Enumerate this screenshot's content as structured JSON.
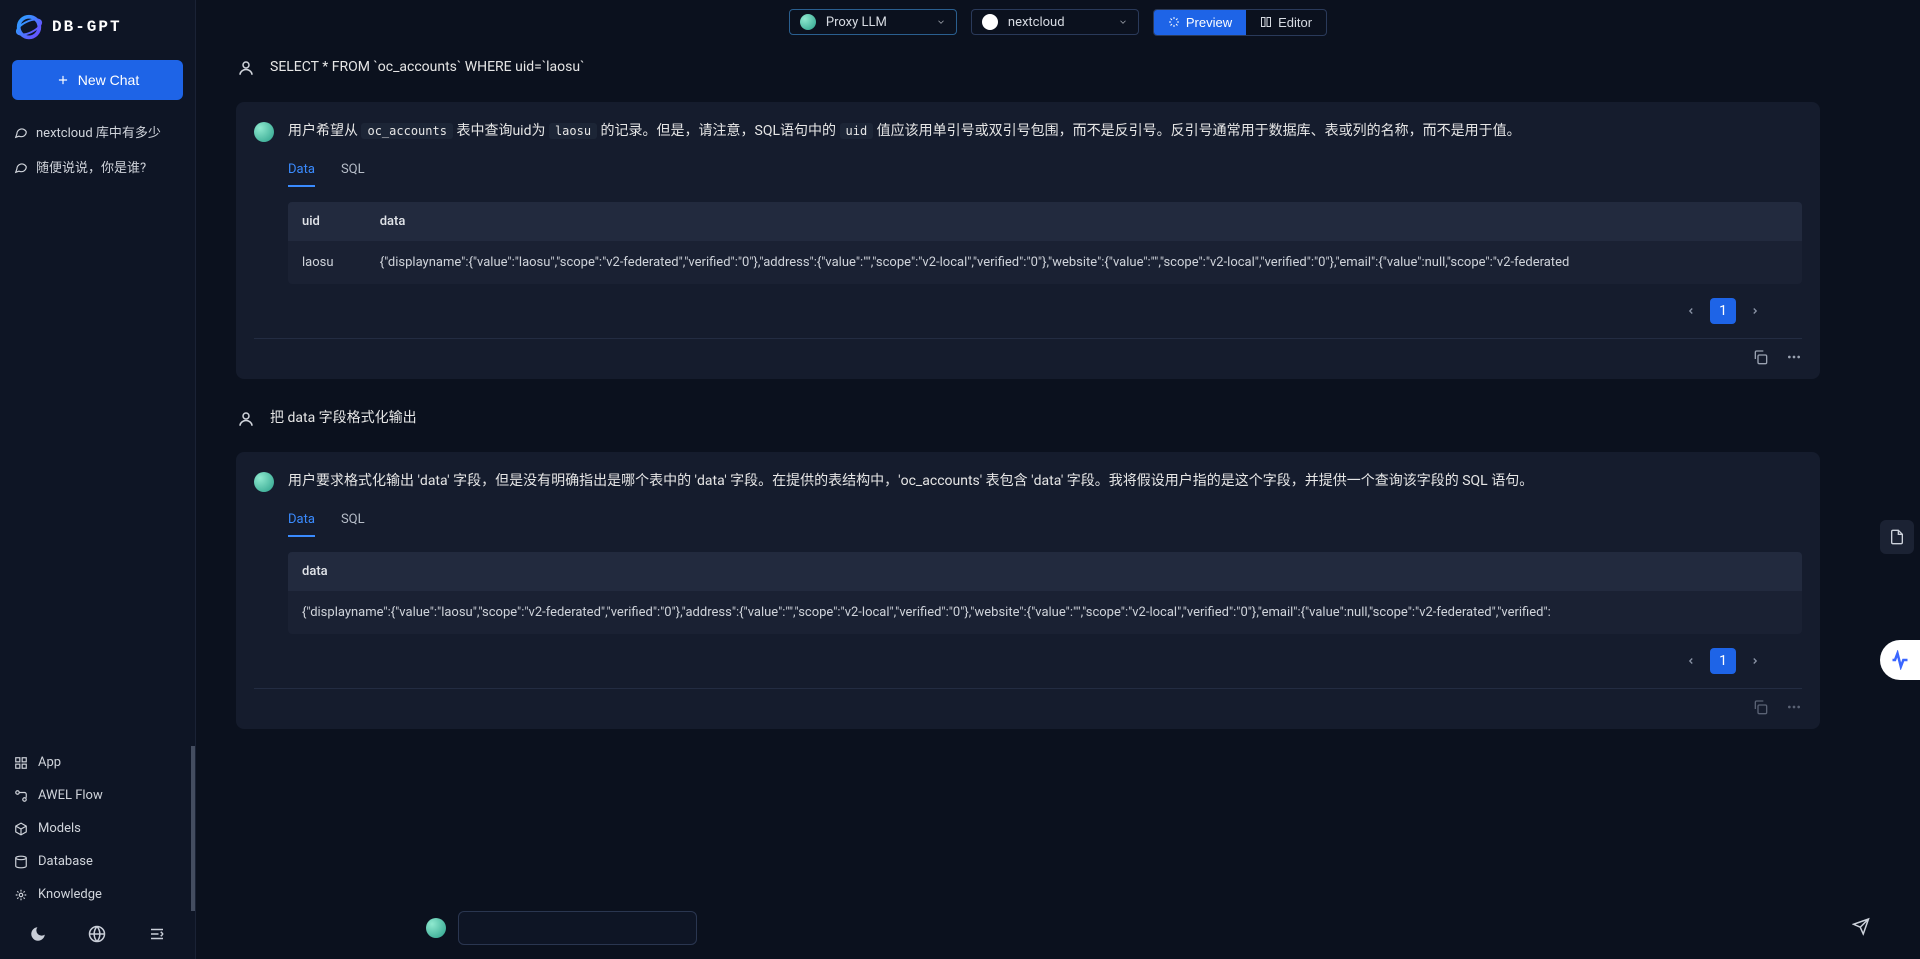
{
  "brand": "DB-GPT",
  "sidebar": {
    "new_chat_label": "New Chat",
    "chats": [
      {
        "title": "nextcloud 库中有多少"
      },
      {
        "title": "随便说说，你是谁?"
      }
    ],
    "nav": {
      "app": "App",
      "awel": "AWEL Flow",
      "models": "Models",
      "database": "Database",
      "knowledge": "Knowledge"
    }
  },
  "topbar": {
    "model_label": "Proxy LLM",
    "db_label": "nextcloud",
    "preview_label": "Preview",
    "editor_label": "Editor"
  },
  "conversation": {
    "user1": "SELECT * FROM `oc_accounts` WHERE uid=`laosu`",
    "bot1": {
      "text_pre": "用户希望从 ",
      "code1": "oc_accounts",
      "text_mid1": " 表中查询uid为 ",
      "code2": "laosu",
      "text_mid2": " 的记录。但是，请注意，SQL语句中的 ",
      "code3": "uid",
      "text_post": " 值应该用单引号或双引号包围，而不是反引号。反引号通常用于数据库、表或列的名称，而不是用于值。",
      "tabs": {
        "data": "Data",
        "sql": "SQL"
      },
      "table": {
        "headers": {
          "c1": "uid",
          "c2": "data"
        },
        "row": {
          "uid": "laosu",
          "data": "{\"displayname\":{\"value\":\"laosu\",\"scope\":\"v2-federated\",\"verified\":\"0\"},\"address\":{\"value\":\"\",\"scope\":\"v2-local\",\"verified\":\"0\"},\"website\":{\"value\":\"\",\"scope\":\"v2-local\",\"verified\":\"0\"},\"email\":{\"value\":null,\"scope\":\"v2-federated"
        }
      },
      "page": "1"
    },
    "user2": "把 data 字段格式化输出",
    "bot2": {
      "text": "用户要求格式化输出 'data' 字段，但是没有明确指出是哪个表中的 'data' 字段。在提供的表结构中，'oc_accounts' 表包含 'data' 字段。我将假设用户指的是这个字段，并提供一个查询该字段的 SQL 语句。",
      "tabs": {
        "data": "Data",
        "sql": "SQL"
      },
      "table": {
        "headers": {
          "c1": "data"
        },
        "row": {
          "data": "{\"displayname\":{\"value\":\"laosu\",\"scope\":\"v2-federated\",\"verified\":\"0\"},\"address\":{\"value\":\"\",\"scope\":\"v2-local\",\"verified\":\"0\"},\"website\":{\"value\":\"\",\"scope\":\"v2-local\",\"verified\":\"0\"},\"email\":{\"value\":null,\"scope\":\"v2-federated\",\"verified\":"
        }
      },
      "page": "1"
    }
  }
}
